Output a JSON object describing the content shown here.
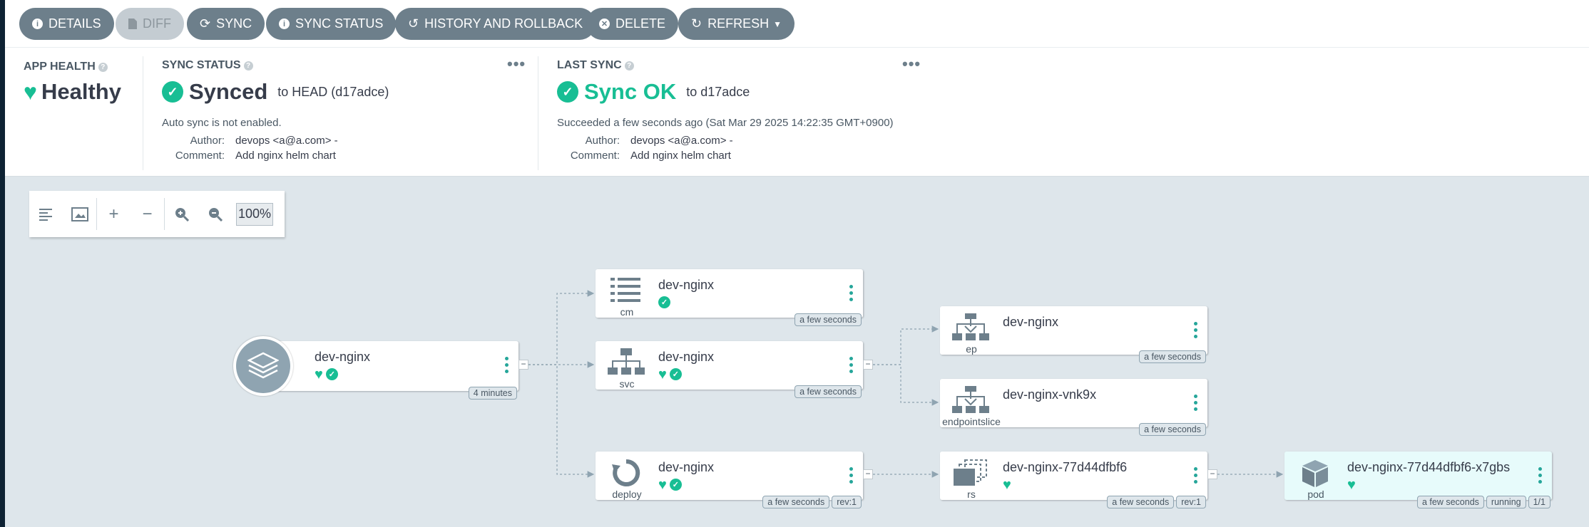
{
  "toolbar": {
    "details": "DETAILS",
    "diff": "DIFF",
    "sync": "SYNC",
    "sync_status": "SYNC STATUS",
    "history": "HISTORY AND ROLLBACK",
    "delete": "DELETE",
    "refresh": "REFRESH"
  },
  "app_health": {
    "title": "APP HEALTH",
    "value": "Healthy",
    "help": "?"
  },
  "sync_status": {
    "title": "SYNC STATUS",
    "value": "Synced",
    "target": "to HEAD (d17adce)",
    "auto_sync": "Auto sync is not enabled.",
    "author_label": "Author:",
    "author": "devops <a@a.com> -",
    "comment_label": "Comment:",
    "comment": "Add nginx helm chart",
    "help": "?"
  },
  "last_sync": {
    "title": "LAST SYNC",
    "value": "Sync OK",
    "target": "to d17adce",
    "succeeded": "Succeeded a few seconds ago (Sat Mar 29 2025 14:22:35 GMT+0900)",
    "author_label": "Author:",
    "author": "devops <a@a.com> -",
    "comment_label": "Comment:",
    "comment": "Add nginx helm chart",
    "help": "?"
  },
  "graph_tools": {
    "zoom": "100%"
  },
  "nodes": {
    "app": {
      "name": "dev-nginx",
      "age": "4 minutes"
    },
    "cm": {
      "name": "dev-nginx",
      "kind": "cm",
      "age": "a few seconds"
    },
    "svc": {
      "name": "dev-nginx",
      "kind": "svc",
      "age": "a few seconds"
    },
    "deploy": {
      "name": "dev-nginx",
      "kind": "deploy",
      "age": "a few seconds",
      "rev": "rev:1"
    },
    "ep": {
      "name": "dev-nginx",
      "kind": "ep",
      "age": "a few seconds"
    },
    "endpointslice": {
      "name": "dev-nginx-vnk9x",
      "kind": "endpointslice",
      "age": "a few seconds"
    },
    "rs": {
      "name": "dev-nginx-77d44dfbf6",
      "kind": "rs",
      "age": "a few seconds",
      "rev": "rev:1"
    },
    "pod": {
      "name": "dev-nginx-77d44dfbf6-x7gbs",
      "kind": "pod",
      "age": "a few seconds",
      "state": "running",
      "ready": "1/1"
    }
  },
  "colors": {
    "healthy": "#18be94",
    "button": "#6d7f8b",
    "background": "#dee6eb"
  }
}
